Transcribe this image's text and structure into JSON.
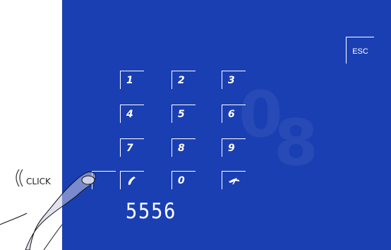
{
  "keypad": {
    "rows": [
      [
        "1",
        "2",
        "3"
      ],
      [
        "4",
        "5",
        "6"
      ],
      [
        "7",
        "8",
        "9"
      ],
      [
        "",
        "0",
        ""
      ]
    ],
    "call_icon": "phone-call-icon",
    "hangup_icon": "phone-hangup-icon"
  },
  "esc_label": "ESC",
  "display_value": "5556",
  "annotation": {
    "click_label": "CLICK"
  },
  "colors": {
    "panel": "#1a3fb3",
    "foreground": "#ffffff"
  }
}
